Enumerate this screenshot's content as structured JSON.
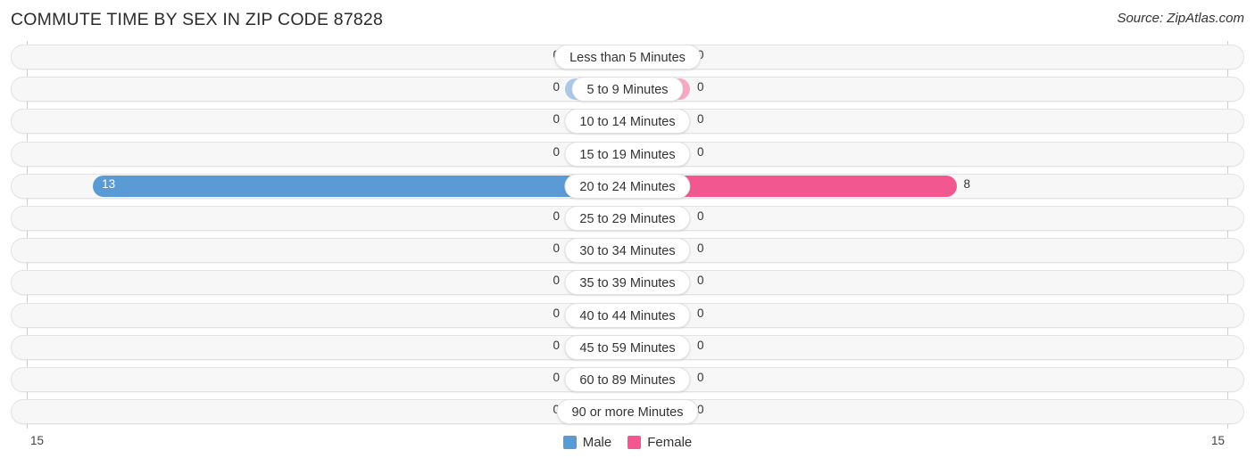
{
  "header": {
    "title": "COMMUTE TIME BY SEX IN ZIP CODE 87828",
    "source": "Source: ZipAtlas.com"
  },
  "legend": {
    "male_label": "Male",
    "female_label": "Female",
    "male_color": "#5b9bd5",
    "female_color": "#f2588f",
    "male_color_muted": "#a8c8ea",
    "female_color_muted": "#f8a8c4"
  },
  "axis": {
    "left_label": "15",
    "right_label": "15",
    "max": 15
  },
  "chart_data": {
    "type": "bar",
    "title": "COMMUTE TIME BY SEX IN ZIP CODE 87828",
    "xlabel": "",
    "ylabel": "",
    "orientation": "horizontal-diverging",
    "xlim": [
      15,
      15
    ],
    "grid": true,
    "legend_position": "bottom-center",
    "categories": [
      "Less than 5 Minutes",
      "5 to 9 Minutes",
      "10 to 14 Minutes",
      "15 to 19 Minutes",
      "20 to 24 Minutes",
      "25 to 29 Minutes",
      "30 to 34 Minutes",
      "35 to 39 Minutes",
      "40 to 44 Minutes",
      "45 to 59 Minutes",
      "60 to 89 Minutes",
      "90 or more Minutes"
    ],
    "series": [
      {
        "name": "Male",
        "values": [
          0,
          0,
          0,
          0,
          13,
          0,
          0,
          0,
          0,
          0,
          0,
          0
        ]
      },
      {
        "name": "Female",
        "values": [
          0,
          0,
          0,
          0,
          8,
          0,
          0,
          0,
          0,
          0,
          0,
          0
        ]
      }
    ]
  },
  "rows": [
    {
      "label": "Less than 5 Minutes",
      "male": "0",
      "female": "0",
      "male_value": 0,
      "female_value": 0
    },
    {
      "label": "5 to 9 Minutes",
      "male": "0",
      "female": "0",
      "male_value": 0,
      "female_value": 0
    },
    {
      "label": "10 to 14 Minutes",
      "male": "0",
      "female": "0",
      "male_value": 0,
      "female_value": 0
    },
    {
      "label": "15 to 19 Minutes",
      "male": "0",
      "female": "0",
      "male_value": 0,
      "female_value": 0
    },
    {
      "label": "20 to 24 Minutes",
      "male": "13",
      "female": "8",
      "male_value": 13,
      "female_value": 8
    },
    {
      "label": "25 to 29 Minutes",
      "male": "0",
      "female": "0",
      "male_value": 0,
      "female_value": 0
    },
    {
      "label": "30 to 34 Minutes",
      "male": "0",
      "female": "0",
      "male_value": 0,
      "female_value": 0
    },
    {
      "label": "35 to 39 Minutes",
      "male": "0",
      "female": "0",
      "male_value": 0,
      "female_value": 0
    },
    {
      "label": "40 to 44 Minutes",
      "male": "0",
      "female": "0",
      "male_value": 0,
      "female_value": 0
    },
    {
      "label": "45 to 59 Minutes",
      "male": "0",
      "female": "0",
      "male_value": 0,
      "female_value": 0
    },
    {
      "label": "60 to 89 Minutes",
      "male": "0",
      "female": "0",
      "male_value": 0,
      "female_value": 0
    },
    {
      "label": "90 or more Minutes",
      "male": "0",
      "female": "0",
      "male_value": 0,
      "female_value": 0
    }
  ]
}
